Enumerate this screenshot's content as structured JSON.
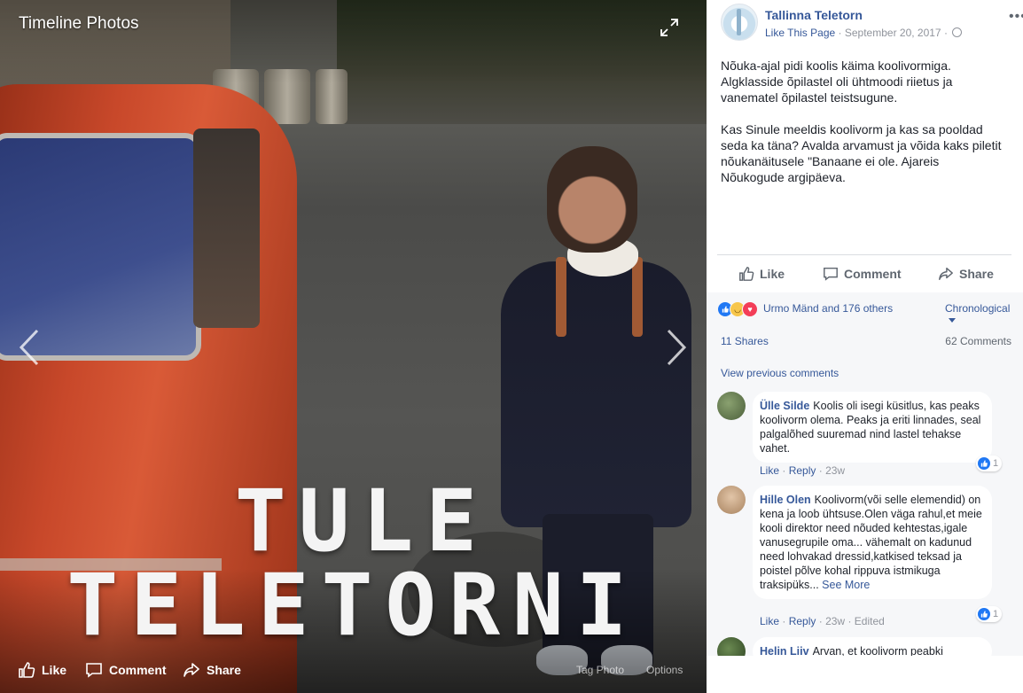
{
  "viewer": {
    "title": "Timeline Photos",
    "overlay_line1": "TULE",
    "overlay_line2": "TELETORNI",
    "actions": {
      "like": "Like",
      "comment": "Comment",
      "share": "Share"
    },
    "tag_photo": "Tag Photo",
    "options": "Options"
  },
  "post": {
    "page_name": "Tallinna Teletorn",
    "like_page": "Like This Page",
    "date": "September 20, 2017",
    "paragraph1": "Nõuka-ajal pidi koolis käima koolivormiga. Algklasside õpilastel oli ühtmoodi riietus ja vanematel õpilastel teistsugune.",
    "paragraph2": "Kas Sinule meeldis koolivorm ja kas sa pooldad seda ka täna? Avalda arvamust ja võida kaks piletit nõukanäitusele \"Banaane ei ole. Ajareis Nõukogude argipäeva.",
    "actions": {
      "like": "Like",
      "comment": "Comment",
      "share": "Share"
    }
  },
  "stats": {
    "reactions_text": "Urmo Mänd and 176 others",
    "sort": "Chronological",
    "shares": "11 Shares",
    "comments": "62 Comments",
    "view_previous": "View previous comments"
  },
  "comments": [
    {
      "author": "Ülle Silde",
      "text": "Koolis oli isegi küsitlus, kas peaks koolivorm olema. Peaks ja eriti linnades, seal palgalõhed suuremad nind lastel tehakse vahet.",
      "see_more": "",
      "like": "Like",
      "reply": "Reply",
      "time": "23w",
      "edited": "",
      "reactions": "1",
      "avatar_color": "#5a6b4a"
    },
    {
      "author": "Hille Olen",
      "text": "Koolivorm(või selle elemendid) on kena ja loob ühtsuse.Olen väga rahul,et meie kooli direktor need nõuded kehtestas,igale vanusegrupile oma... vähemalt on kadunud need lohvakad dressid,katkised teksad ja poistel põlve kohal rippuva istmikuga traksipüks...",
      "see_more": "See More",
      "like": "Like",
      "reply": "Reply",
      "time": "23w",
      "edited": "Edited",
      "reactions": "1",
      "avatar_color": "#c9a98a"
    },
    {
      "author": "Helin Liiv",
      "text": "Arvan, et koolivorm peabki",
      "avatar_color": "#3b5a2e"
    }
  ]
}
